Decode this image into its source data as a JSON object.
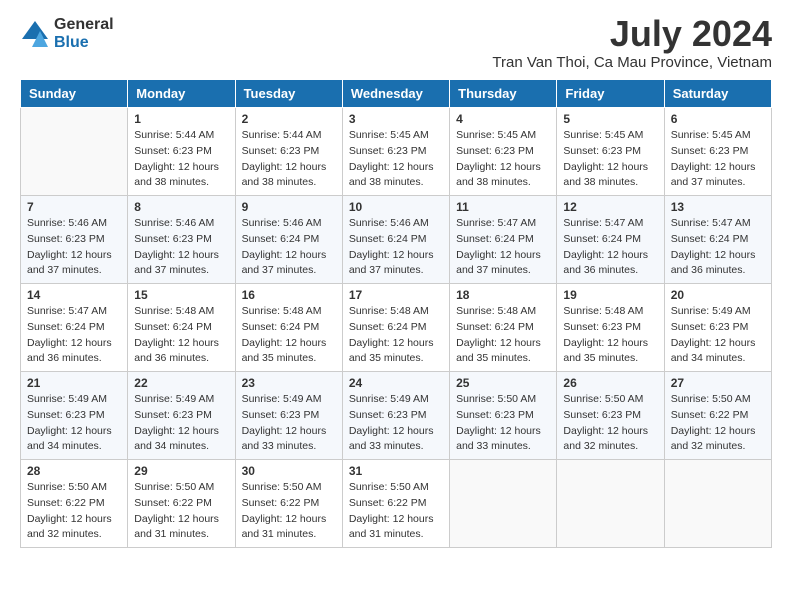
{
  "logo": {
    "general": "General",
    "blue": "Blue"
  },
  "header": {
    "month_year": "July 2024",
    "location": "Tran Van Thoi, Ca Mau Province, Vietnam"
  },
  "days_of_week": [
    "Sunday",
    "Monday",
    "Tuesday",
    "Wednesday",
    "Thursday",
    "Friday",
    "Saturday"
  ],
  "weeks": [
    [
      {
        "day": "",
        "info": ""
      },
      {
        "day": "1",
        "info": "Sunrise: 5:44 AM\nSunset: 6:23 PM\nDaylight: 12 hours\nand 38 minutes."
      },
      {
        "day": "2",
        "info": "Sunrise: 5:44 AM\nSunset: 6:23 PM\nDaylight: 12 hours\nand 38 minutes."
      },
      {
        "day": "3",
        "info": "Sunrise: 5:45 AM\nSunset: 6:23 PM\nDaylight: 12 hours\nand 38 minutes."
      },
      {
        "day": "4",
        "info": "Sunrise: 5:45 AM\nSunset: 6:23 PM\nDaylight: 12 hours\nand 38 minutes."
      },
      {
        "day": "5",
        "info": "Sunrise: 5:45 AM\nSunset: 6:23 PM\nDaylight: 12 hours\nand 38 minutes."
      },
      {
        "day": "6",
        "info": "Sunrise: 5:45 AM\nSunset: 6:23 PM\nDaylight: 12 hours\nand 37 minutes."
      }
    ],
    [
      {
        "day": "7",
        "info": "Sunrise: 5:46 AM\nSunset: 6:23 PM\nDaylight: 12 hours\nand 37 minutes."
      },
      {
        "day": "8",
        "info": "Sunrise: 5:46 AM\nSunset: 6:23 PM\nDaylight: 12 hours\nand 37 minutes."
      },
      {
        "day": "9",
        "info": "Sunrise: 5:46 AM\nSunset: 6:24 PM\nDaylight: 12 hours\nand 37 minutes."
      },
      {
        "day": "10",
        "info": "Sunrise: 5:46 AM\nSunset: 6:24 PM\nDaylight: 12 hours\nand 37 minutes."
      },
      {
        "day": "11",
        "info": "Sunrise: 5:47 AM\nSunset: 6:24 PM\nDaylight: 12 hours\nand 37 minutes."
      },
      {
        "day": "12",
        "info": "Sunrise: 5:47 AM\nSunset: 6:24 PM\nDaylight: 12 hours\nand 36 minutes."
      },
      {
        "day": "13",
        "info": "Sunrise: 5:47 AM\nSunset: 6:24 PM\nDaylight: 12 hours\nand 36 minutes."
      }
    ],
    [
      {
        "day": "14",
        "info": "Sunrise: 5:47 AM\nSunset: 6:24 PM\nDaylight: 12 hours\nand 36 minutes."
      },
      {
        "day": "15",
        "info": "Sunrise: 5:48 AM\nSunset: 6:24 PM\nDaylight: 12 hours\nand 36 minutes."
      },
      {
        "day": "16",
        "info": "Sunrise: 5:48 AM\nSunset: 6:24 PM\nDaylight: 12 hours\nand 35 minutes."
      },
      {
        "day": "17",
        "info": "Sunrise: 5:48 AM\nSunset: 6:24 PM\nDaylight: 12 hours\nand 35 minutes."
      },
      {
        "day": "18",
        "info": "Sunrise: 5:48 AM\nSunset: 6:24 PM\nDaylight: 12 hours\nand 35 minutes."
      },
      {
        "day": "19",
        "info": "Sunrise: 5:48 AM\nSunset: 6:23 PM\nDaylight: 12 hours\nand 35 minutes."
      },
      {
        "day": "20",
        "info": "Sunrise: 5:49 AM\nSunset: 6:23 PM\nDaylight: 12 hours\nand 34 minutes."
      }
    ],
    [
      {
        "day": "21",
        "info": "Sunrise: 5:49 AM\nSunset: 6:23 PM\nDaylight: 12 hours\nand 34 minutes."
      },
      {
        "day": "22",
        "info": "Sunrise: 5:49 AM\nSunset: 6:23 PM\nDaylight: 12 hours\nand 34 minutes."
      },
      {
        "day": "23",
        "info": "Sunrise: 5:49 AM\nSunset: 6:23 PM\nDaylight: 12 hours\nand 33 minutes."
      },
      {
        "day": "24",
        "info": "Sunrise: 5:49 AM\nSunset: 6:23 PM\nDaylight: 12 hours\nand 33 minutes."
      },
      {
        "day": "25",
        "info": "Sunrise: 5:50 AM\nSunset: 6:23 PM\nDaylight: 12 hours\nand 33 minutes."
      },
      {
        "day": "26",
        "info": "Sunrise: 5:50 AM\nSunset: 6:23 PM\nDaylight: 12 hours\nand 32 minutes."
      },
      {
        "day": "27",
        "info": "Sunrise: 5:50 AM\nSunset: 6:22 PM\nDaylight: 12 hours\nand 32 minutes."
      }
    ],
    [
      {
        "day": "28",
        "info": "Sunrise: 5:50 AM\nSunset: 6:22 PM\nDaylight: 12 hours\nand 32 minutes."
      },
      {
        "day": "29",
        "info": "Sunrise: 5:50 AM\nSunset: 6:22 PM\nDaylight: 12 hours\nand 31 minutes."
      },
      {
        "day": "30",
        "info": "Sunrise: 5:50 AM\nSunset: 6:22 PM\nDaylight: 12 hours\nand 31 minutes."
      },
      {
        "day": "31",
        "info": "Sunrise: 5:50 AM\nSunset: 6:22 PM\nDaylight: 12 hours\nand 31 minutes."
      },
      {
        "day": "",
        "info": ""
      },
      {
        "day": "",
        "info": ""
      },
      {
        "day": "",
        "info": ""
      }
    ]
  ]
}
